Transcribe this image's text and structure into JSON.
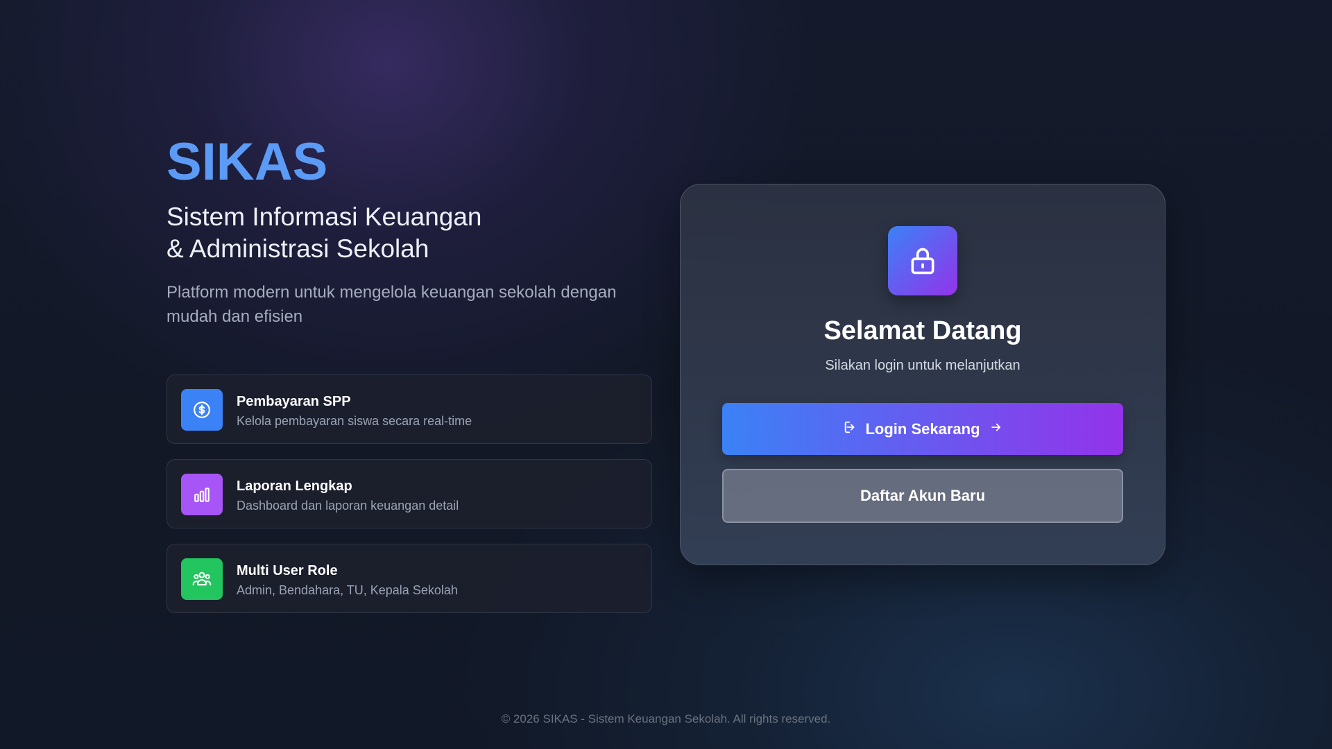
{
  "brand": {
    "name": "SIKAS",
    "tagline_line1": "Sistem Informasi Keuangan",
    "tagline_line2": "& Administrasi Sekolah",
    "description": "Platform modern untuk mengelola keuangan sekolah dengan mudah dan efisien"
  },
  "features": [
    {
      "icon": "dollar-circle-icon",
      "color": "#3b82f6",
      "title": "Pembayaran SPP",
      "description": "Kelola pembayaran siswa secara real-time"
    },
    {
      "icon": "bar-chart-icon",
      "color": "#a855f7",
      "title": "Laporan Lengkap",
      "description": "Dashboard dan laporan keuangan detail"
    },
    {
      "icon": "users-icon",
      "color": "#22c55e",
      "title": "Multi User Role",
      "description": "Admin, Bendahara, TU, Kepala Sekolah"
    }
  ],
  "login_card": {
    "icon": "lock-icon",
    "title": "Selamat Datang",
    "subtitle": "Silakan login untuk melanjutkan",
    "login_button": "Login Sekarang",
    "register_button": "Daftar Akun Baru"
  },
  "footer": {
    "text": "© 2026 SIKAS - Sistem Keuangan Sekolah. All rights reserved."
  },
  "colors": {
    "accent_blue": "#5b9bf6",
    "gradient_start": "#3b82f6",
    "gradient_end": "#9333ea"
  }
}
